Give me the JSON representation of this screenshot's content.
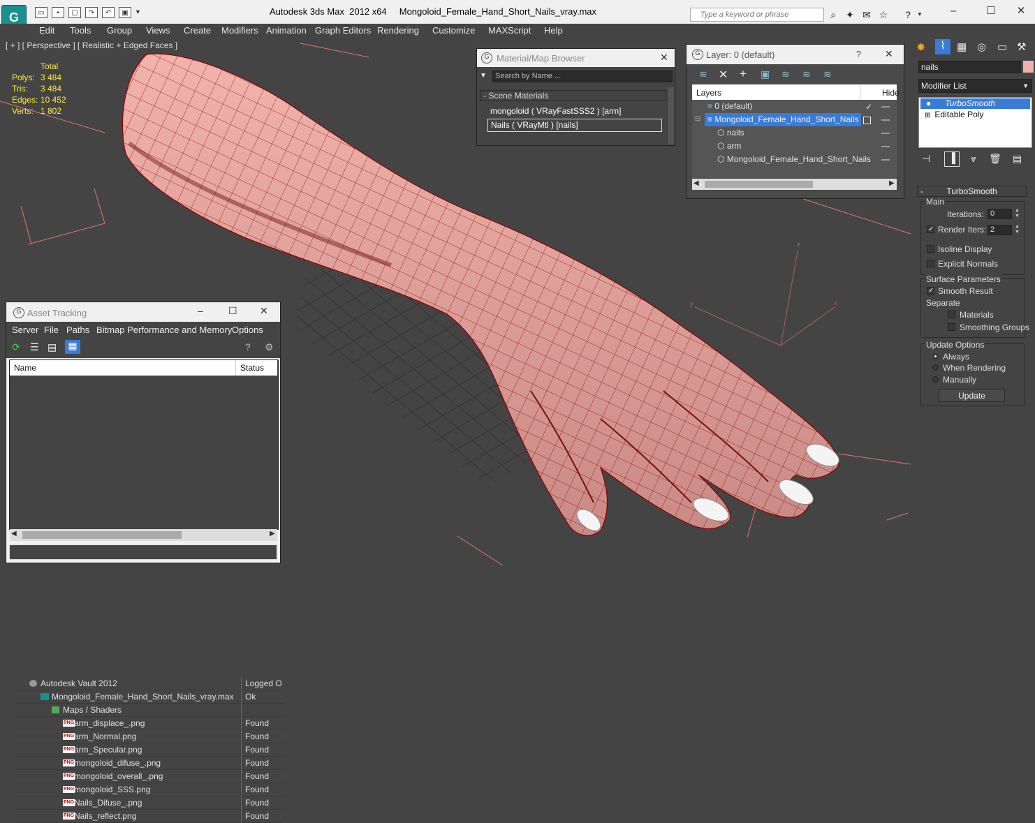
{
  "titlebar": {
    "app_name": "Autodesk 3ds Max  2012 x64",
    "file_name": "Mongoloid_Female_Hand_Short_Nails_vray.max",
    "search_placeholder": "Type a keyword or phrase"
  },
  "menu": [
    "Edit",
    "Tools",
    "Group",
    "Views",
    "Create",
    "Modifiers",
    "Animation",
    "Graph Editors",
    "Rendering",
    "Customize",
    "MAXScript",
    "Help"
  ],
  "viewport": {
    "label": "[ + ] [ Perspective ] [ Realistic + Edged Faces ]",
    "stats_header": "Total",
    "stats": [
      {
        "label": "Polys:",
        "value": "3 484"
      },
      {
        "label": "Tris:",
        "value": "3 484"
      },
      {
        "label": "Edges:",
        "value": "10 452"
      },
      {
        "label": "Verts:",
        "value": "1 802"
      }
    ],
    "gizmo_axes": {
      "z": "z",
      "y": "y",
      "x": "x"
    }
  },
  "material_browser": {
    "title": "Material/Map Browser",
    "search_placeholder": "Search by Name ...",
    "section": "- Scene Materials",
    "items": [
      "mongoloid  ( VRayFastSSS2 )  [arm]",
      "Nails  ( VRayMtl )  [nails]"
    ]
  },
  "layer_dialog": {
    "title": "Layer: 0 (default)",
    "help": "?",
    "col_layers": "Layers",
    "col_hide": "Hide",
    "rows": [
      {
        "label": "0 (default)",
        "indent": 0,
        "selected": false
      },
      {
        "label": "Mongoloid_Female_Hand_Short_Nails",
        "indent": 0,
        "selected": true
      },
      {
        "label": "nails",
        "indent": 1,
        "selected": false
      },
      {
        "label": "arm",
        "indent": 1,
        "selected": false
      },
      {
        "label": "Mongoloid_Female_Hand_Short_Nails",
        "indent": 1,
        "selected": false
      }
    ]
  },
  "asset_tracking": {
    "title": "Asset Tracking",
    "menu": [
      "Server",
      "File",
      "Paths",
      "Bitmap Performance and Memory",
      "Options"
    ],
    "col_name": "Name",
    "col_status": "Status",
    "rows": [
      {
        "name": "Autodesk Vault 2012",
        "status": "Logged O",
        "indent": 0,
        "icon": "vault-icon"
      },
      {
        "name": "Mongoloid_Female_Hand_Short_Nails_vray.max",
        "status": "Ok",
        "indent": 1,
        "icon": "max-file-icon"
      },
      {
        "name": "Maps / Shaders",
        "status": "",
        "indent": 2,
        "icon": "maps-icon"
      },
      {
        "name": "arm_displace_.png",
        "status": "Found",
        "indent": 3,
        "icon": "png-icon"
      },
      {
        "name": "arm_Normal.png",
        "status": "Found",
        "indent": 3,
        "icon": "png-icon"
      },
      {
        "name": "arm_Specular.png",
        "status": "Found",
        "indent": 3,
        "icon": "png-icon"
      },
      {
        "name": "mongoloid_difuse_.png",
        "status": "Found",
        "indent": 3,
        "icon": "png-icon"
      },
      {
        "name": "mongoloid_overall_.png",
        "status": "Found",
        "indent": 3,
        "icon": "png-icon"
      },
      {
        "name": "mongoloid_SSS.png",
        "status": "Found",
        "indent": 3,
        "icon": "png-icon"
      },
      {
        "name": "Nails_Difuse_.png",
        "status": "Found",
        "indent": 3,
        "icon": "png-icon"
      },
      {
        "name": "Nails_reflect.png",
        "status": "Found",
        "indent": 3,
        "icon": "png-icon"
      }
    ],
    "png_tag": "PNG"
  },
  "command_panel": {
    "object_name": "nails",
    "modifier_list": "Modifier List",
    "stack": [
      "TurboSmooth",
      "Editable Poly"
    ],
    "rollout_title": "TurboSmooth",
    "main_label": "Main",
    "iterations_label": "Iterations:",
    "iterations_value": "0",
    "render_iters_label": "Render Iters:",
    "render_iters_value": "2",
    "render_iters_checked": true,
    "isoline_label": "Isoline Display",
    "explicit_normals_label": "Explicit Normals",
    "surface_params_label": "Surface Parameters",
    "smooth_result_label": "Smooth Result",
    "separate_label": "Separate",
    "materials_label": "Materials",
    "smoothing_groups_label": "Smoothing Groups",
    "update_options_label": "Update Options",
    "update_always": "Always",
    "update_when_rendering": "When Rendering",
    "update_manually": "Manually",
    "update_button": "Update"
  },
  "colors": {
    "accent": "#3a7bd5",
    "mesh": "#e8a09a",
    "wire": "#8b0000",
    "viewport_bg": "#444444"
  }
}
